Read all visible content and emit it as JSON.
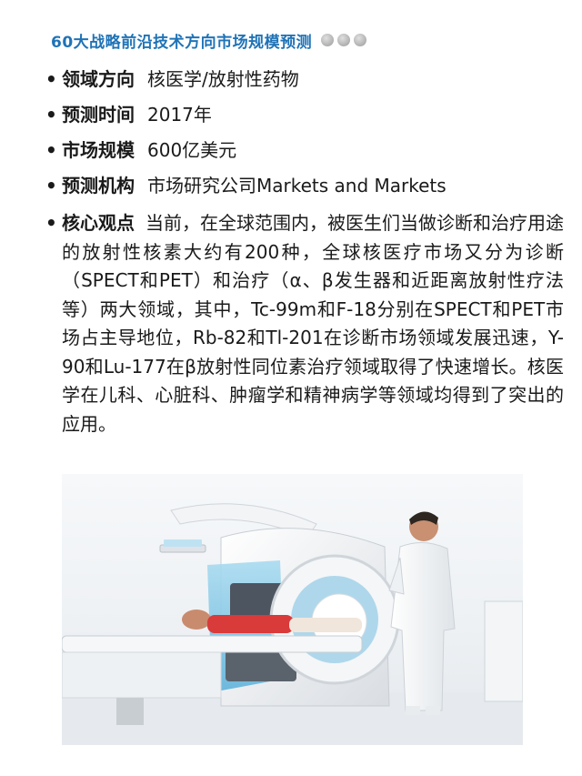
{
  "header": {
    "title": "60大战略前沿技术方向市场规模预测",
    "dot_color": "#b0b0b0"
  },
  "items": [
    {
      "label": "领域方向",
      "value": "核医学/放射性药物"
    },
    {
      "label": "预测时间",
      "value": "2017年"
    },
    {
      "label": "市场规模",
      "value": "600亿美元"
    },
    {
      "label": "预测机构",
      "value": "市场研究公司Markets and Markets"
    }
  ],
  "core": {
    "label": "核心观点",
    "text": "当前，在全球范围内，被医生们当做诊断和治疗用途的放射性核素大约有200种，全球核医疗市场又分为诊断（SPECT和PET）和治疗（α、β发生器和近距离放射性疗法等）两大领域，其中，Tc-99m和F-18分别在SPECT和PET市场占主导地位，Rb-82和Tl-201在诊断市场领域发展迅速，Y-90和Lu-177在β放射性同位素治疗领域取得了快速增长。核医学在儿科、心脏科、肿瘤学和精神病学等领域均得到了突出的应用。"
  },
  "image": {
    "subject": "SPECT scanner with doctor and patient",
    "accent_color": "#7fc3e3"
  }
}
